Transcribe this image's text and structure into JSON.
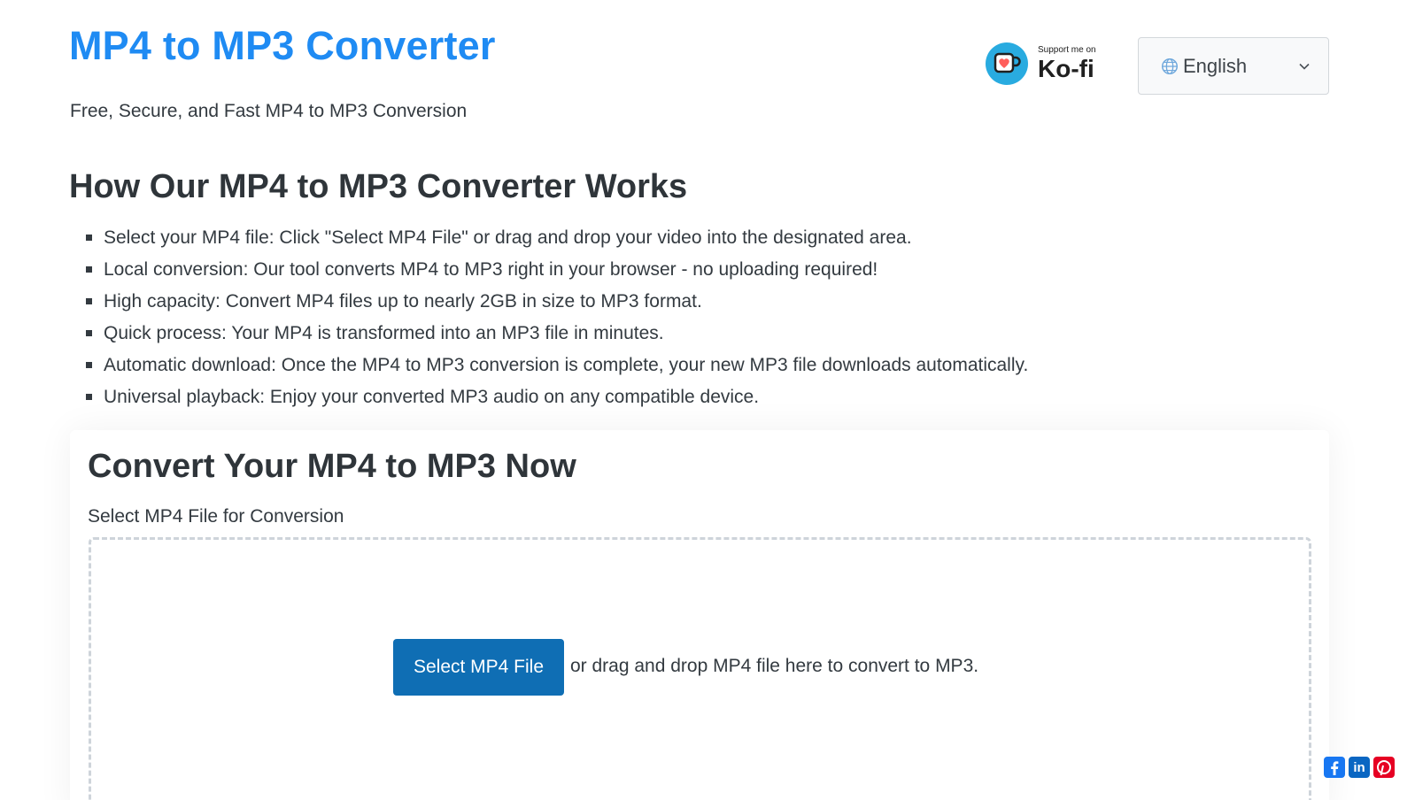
{
  "header": {
    "title": "MP4 to MP3 Converter",
    "tagline": "Free, Secure, and Fast MP4 to MP3 Conversion"
  },
  "kofi": {
    "small": "Support me on",
    "big": "Ko-fi",
    "icon": "kofi-cup-icon",
    "color": "#29abe0"
  },
  "language": {
    "selected": "English",
    "icon": "globe-icon"
  },
  "how": {
    "title": "How Our MP4 to MP3 Converter Works",
    "steps": [
      "Select your MP4 file: Click \"Select MP4 File\" or drag and drop your video into the designated area.",
      "Local conversion: Our tool converts MP4 to MP3 right in your browser - no uploading required!",
      "High capacity: Convert MP4 files up to nearly 2GB in size to MP3 format.",
      "Quick process: Your MP4 is transformed into an MP3 file in minutes.",
      "Automatic download: Once the MP4 to MP3 conversion is complete, your new MP3 file downloads automatically.",
      "Universal playback: Enjoy your converted MP3 audio on any compatible device."
    ]
  },
  "converter": {
    "title": "Convert Your MP4 to MP3 Now",
    "label": "Select MP4 File for Conversion",
    "button": "Select MP4 File",
    "drop_text": "or drag and drop MP4 file here to convert to MP3."
  },
  "share": {
    "linkedin_text": "in",
    "icons": [
      "facebook-icon",
      "linkedin-icon",
      "pinterest-icon"
    ]
  },
  "colors": {
    "title_blue": "#1f8bf3",
    "button_blue": "#0f6eb4",
    "text": "#333a40"
  }
}
